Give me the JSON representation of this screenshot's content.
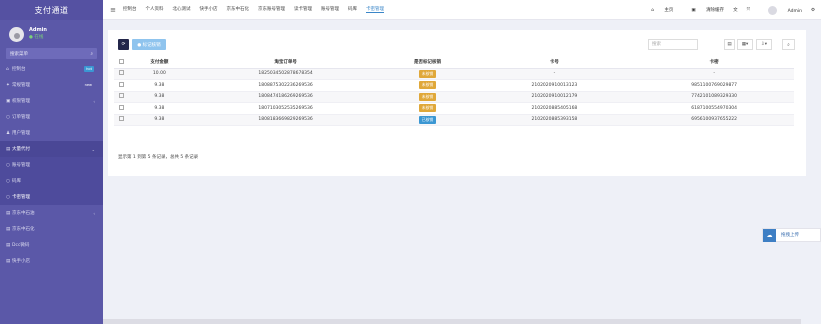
{
  "sidebar": {
    "brand": "支付通道",
    "user": {
      "name": "Admin",
      "status": "在线"
    },
    "search_label": "搜索菜单",
    "items": [
      {
        "label": "控制台",
        "icon": "dashboard-icon",
        "icon_glyph": "⌂",
        "badge": "hot",
        "badge_color": "#3b97d3"
      },
      {
        "label": "常规管理",
        "icon": "cogs-icon",
        "icon_glyph": "✦",
        "badge": "new",
        "badge_color": "#5b58a8"
      },
      {
        "label": "权限管理",
        "icon": "group-icon",
        "icon_glyph": "▣",
        "arrow": "‹"
      },
      {
        "label": "订单管理",
        "icon": "circle-icon",
        "icon_glyph": "○"
      },
      {
        "label": "用户管理",
        "icon": "user-icon",
        "icon_glyph": "♟"
      },
      {
        "label": "大量代付",
        "icon": "list-icon",
        "icon_glyph": "▤",
        "arrow": "⌄"
      },
      {
        "label": "账号管理",
        "icon": "circle-icon",
        "icon_glyph": "○"
      },
      {
        "label": "码库",
        "icon": "circle-icon",
        "icon_glyph": "○"
      },
      {
        "label": "卡密管理",
        "icon": "circle-icon",
        "icon_glyph": "○"
      },
      {
        "label": "京东中石油",
        "icon": "list-icon",
        "icon_glyph": "▤",
        "arrow": "‹"
      },
      {
        "label": "京东中石化",
        "icon": "list-icon",
        "icon_glyph": "▤"
      },
      {
        "label": "Dcc微码",
        "icon": "list-icon",
        "icon_glyph": "▤"
      },
      {
        "label": "快手小店",
        "icon": "list-icon",
        "icon_glyph": "▤"
      }
    ]
  },
  "topbar": {
    "menu_icon": "≡",
    "nav": [
      "控制台",
      "个人资料",
      "北心测试",
      "快手小店",
      "京东中石化",
      "京东账号管理",
      "读卡管理",
      "账号管理",
      "码库",
      "卡密管理"
    ],
    "active_nav": 9,
    "right": {
      "home": "主页",
      "clear_cache": "清除缓存",
      "user": "Admin"
    }
  },
  "toolbar": {
    "refresh_icon": "⟳",
    "mark_button": "● 标记核销",
    "search_placeholder": "搜索"
  },
  "table": {
    "columns": [
      "",
      "支付金额",
      "淘宝订单号",
      "是否标记核销",
      "卡号",
      "卡密"
    ],
    "rows": [
      {
        "amount": "10.00",
        "order": "1825034502878678354",
        "status": "未核销",
        "card_no": "-",
        "card_secret": "-"
      },
      {
        "amount": "9.38",
        "order": "1808875302236269536",
        "status": "未核销",
        "card_no": "2102020910013123",
        "card_secret": "9851100769029877"
      },
      {
        "amount": "9.38",
        "order": "1808474186269269536",
        "status": "未核销",
        "card_no": "2102020910012179",
        "card_secret": "7742101089329330"
      },
      {
        "amount": "9.38",
        "order": "1807103052535269536",
        "status": "未核销",
        "card_no": "2102020885405168",
        "card_secret": "6187100554970304"
      },
      {
        "amount": "9.38",
        "order": "1808183669829269536",
        "status": "已核销",
        "card_no": "2102020885393158",
        "card_secret": "6956100937655222"
      }
    ],
    "status_colors": {
      "未核销": "#e0a83a",
      "已核销": "#3b97d3"
    },
    "footer": "显示第 1 到第 5 条记录，总共 5 条记录"
  },
  "upload": {
    "label": "拖拽上传"
  }
}
